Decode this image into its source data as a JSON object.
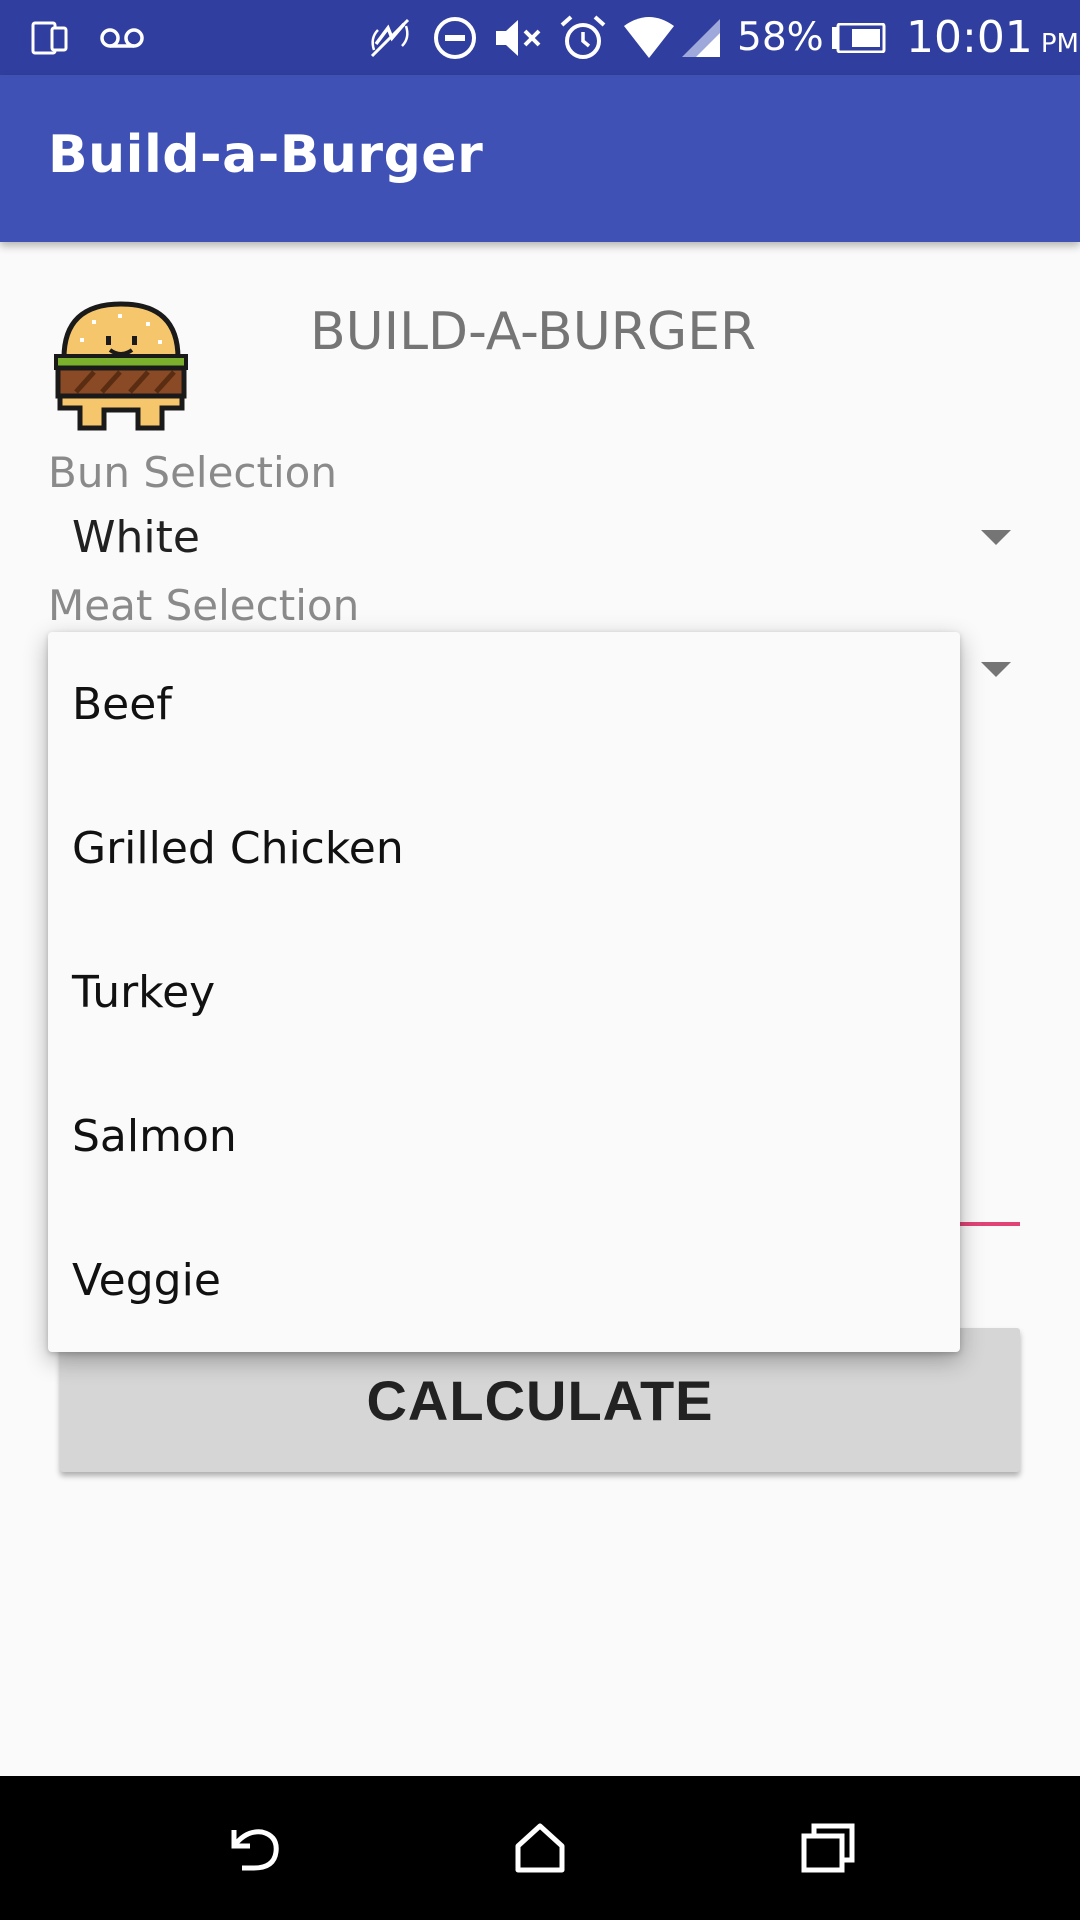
{
  "status_bar": {
    "battery_percent": "58%",
    "time": "10:01",
    "ampm": "PM",
    "icons": [
      "sim-card-icon",
      "voicemail-icon",
      "nfc-icon",
      "do-not-disturb-icon",
      "mute-icon",
      "alarm-icon",
      "wifi-icon",
      "cell-signal-icon",
      "battery-icon"
    ]
  },
  "app_bar": {
    "title": "Build-a-Burger"
  },
  "main": {
    "heading": "BUILD-A-BURGER",
    "logo_icon": "burger-icon",
    "bun": {
      "label": "Bun Selection",
      "value": "White"
    },
    "meat": {
      "label": "Meat Selection"
    },
    "calculate_label": "CALCULATE"
  },
  "dropdown": {
    "options": [
      "Beef",
      "Grilled Chicken",
      "Turkey",
      "Salmon",
      "Veggie"
    ]
  },
  "nav_bar": {
    "icons": [
      "back-icon",
      "home-icon",
      "recents-icon"
    ]
  },
  "colors": {
    "status_bar": "#303f9f",
    "app_bar": "#3f51b5",
    "accent": "#e04476"
  }
}
